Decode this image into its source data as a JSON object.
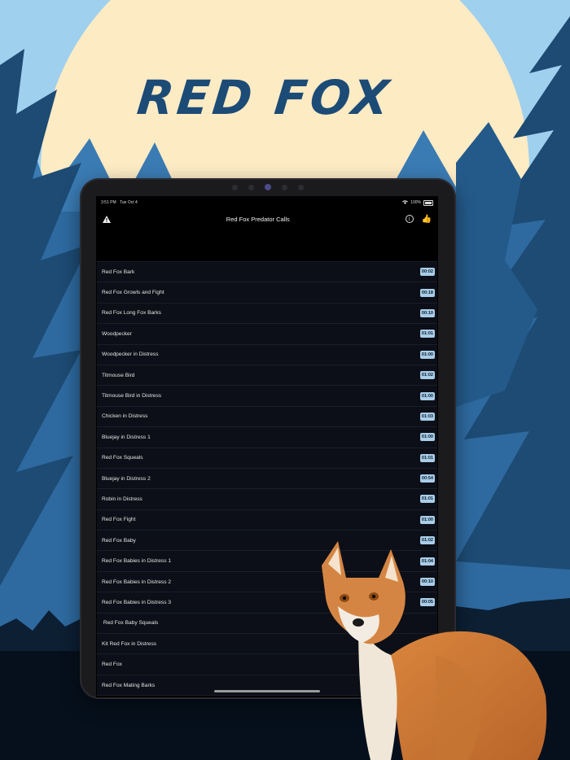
{
  "promo": {
    "headline": "RED FOX"
  },
  "status_bar": {
    "time": "3:51 PM",
    "date": "Tue Oct 4",
    "battery": "100%"
  },
  "nav": {
    "title": "Red Fox Predator Calls",
    "left_icon": "warning-icon",
    "right_icons": [
      "info-icon",
      "thumbs-up-icon"
    ]
  },
  "calls": [
    {
      "title": "Red Fox Bark",
      "duration": "00:02"
    },
    {
      "title": "Red Fox Growls and Fight",
      "duration": "00:18"
    },
    {
      "title": "Red Fox Long Fox Barks",
      "duration": "00:10"
    },
    {
      "title": "Woodpecker",
      "duration": "01:01"
    },
    {
      "title": "Woodpecker in Distress",
      "duration": "01:00"
    },
    {
      "title": "Titmouse Bird",
      "duration": "01:02"
    },
    {
      "title": "Titmouse Bird in Distress",
      "duration": "01:00"
    },
    {
      "title": "Chicken in Distress",
      "duration": "01:03"
    },
    {
      "title": "Bluejay in Distress 1",
      "duration": "01:00"
    },
    {
      "title": "Red Fox Squeals",
      "duration": "01:01"
    },
    {
      "title": "Bluejay in Distress 2",
      "duration": "00:54"
    },
    {
      "title": "Robin in Distress",
      "duration": "01:01"
    },
    {
      "title": "Red Fox Fight",
      "duration": "01:00"
    },
    {
      "title": "Red Fox Baby",
      "duration": "01:02"
    },
    {
      "title": "Red Fox Babies in Distress 1",
      "duration": "01:04"
    },
    {
      "title": "Red Fox Babies in Distress 2",
      "duration": "00:10"
    },
    {
      "title": "Red Fox Babies in Distress 3",
      "duration": "00:05"
    },
    {
      "title": " Red Fox Baby Squeals",
      "duration": ""
    },
    {
      "title": "Kit Red Fox in Distress",
      "duration": ""
    },
    {
      "title": "Red Fox",
      "duration": ""
    },
    {
      "title": "Red Fox Mating Barks",
      "duration": ""
    }
  ],
  "colors": {
    "sky": "#9fd0ee",
    "moon": "#fdebc4",
    "tree_dark": "#1d4b74",
    "tree_light": "#3a7bb3",
    "badge": "#a9cde8"
  }
}
